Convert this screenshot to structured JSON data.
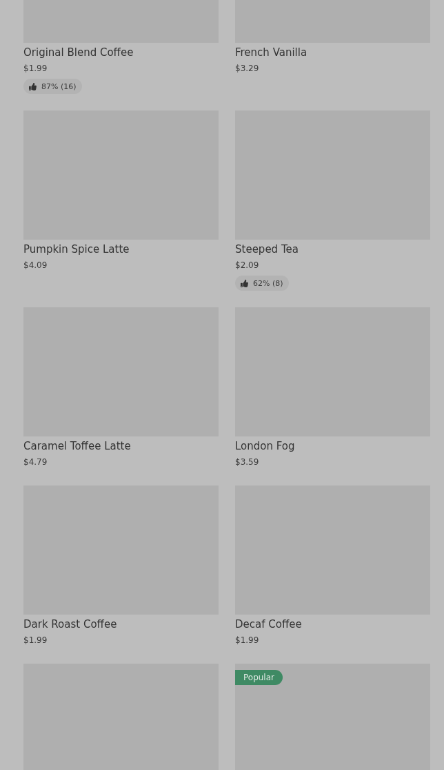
{
  "products": [
    {
      "kind": "product",
      "name": "Original Blend Coffee",
      "price": "$1.99",
      "rating": "87% (16)"
    },
    {
      "kind": "product",
      "name": "French Vanilla",
      "price": "$3.29"
    },
    {
      "kind": "product",
      "name": "Pumpkin Spice Latte",
      "price": "$4.09"
    },
    {
      "kind": "product",
      "name": "Steeped Tea",
      "price": "$2.09",
      "rating": "62% (8)"
    },
    {
      "kind": "product",
      "name": "Caramel Toffee Latte",
      "price": "$4.79"
    },
    {
      "kind": "product",
      "name": "London Fog",
      "price": "$3.59"
    },
    {
      "kind": "product",
      "name": "Dark Roast Coffee",
      "price": "$1.99"
    },
    {
      "kind": "product",
      "name": "Decaf Coffee",
      "price": "$1.99"
    },
    {
      "kind": "image-only"
    },
    {
      "kind": "image-only",
      "badge": "Popular"
    }
  ]
}
